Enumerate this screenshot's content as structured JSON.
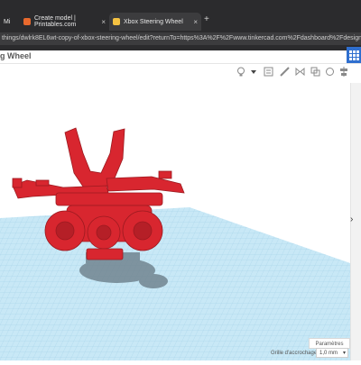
{
  "browser": {
    "tabs": [
      {
        "label": "Mi",
        "active": false
      },
      {
        "label": "Create model | Printables.com",
        "active": false
      },
      {
        "label": "Xbox Steering Wheel",
        "active": true
      }
    ],
    "new_tab": "+",
    "url": "things/dwlrk8EL6wt-copy-of-xbox-steering-wheel/edit?returnTo=https%3A%2F%2Fwww.tinkercad.com%2Fdashboard%2Fdesigns%2F3d%3Fp"
  },
  "app": {
    "title": "g Wheel",
    "accent": "#2f6fcf"
  },
  "toolbar": {
    "icons": [
      "lightbulb-icon",
      "caret-down-icon",
      "note-icon",
      "ruler-icon",
      "mirror-icon",
      "group-icon",
      "ungroup-icon",
      "align-icon"
    ]
  },
  "workplane": {
    "grid_color": "#b9dff0",
    "model_color": "#d8262f"
  },
  "footer": {
    "params_label": "Paramètres",
    "snap_label": "Grille d'accrochage",
    "snap_value": "1,0 mm"
  },
  "sidebar": {
    "collapse_glyph": "›"
  }
}
